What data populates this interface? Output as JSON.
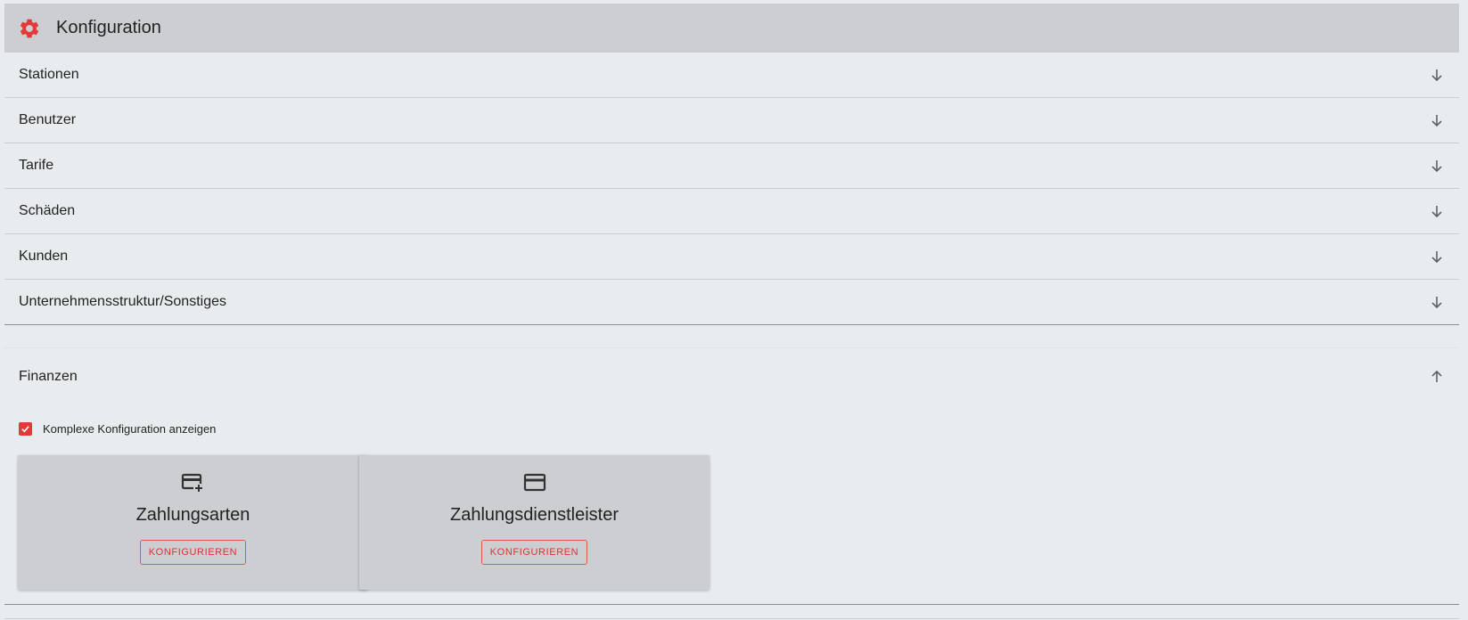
{
  "header": {
    "title": "Konfiguration",
    "icon": "gear-icon",
    "accent_color": "#e23a3a"
  },
  "panels": [
    {
      "label": "Stationen",
      "expanded": false
    },
    {
      "label": "Benutzer",
      "expanded": false
    },
    {
      "label": "Tarife",
      "expanded": false
    },
    {
      "label": "Schäden",
      "expanded": false
    },
    {
      "label": "Kunden",
      "expanded": false
    },
    {
      "label": "Unternehmensstruktur/Sonstiges",
      "expanded": false
    }
  ],
  "finanzen": {
    "label": "Finanzen",
    "expanded": true,
    "checkbox": {
      "label": "Komplexe Konfiguration anzeigen",
      "checked": true
    },
    "cards": [
      {
        "title": "Zahlungsarten",
        "icon": "add-card-icon",
        "button": "KONFIGURIEREN"
      },
      {
        "title": "Zahlungsdienstleister",
        "icon": "credit-card-icon",
        "button": "KONFIGURIEREN"
      }
    ]
  }
}
